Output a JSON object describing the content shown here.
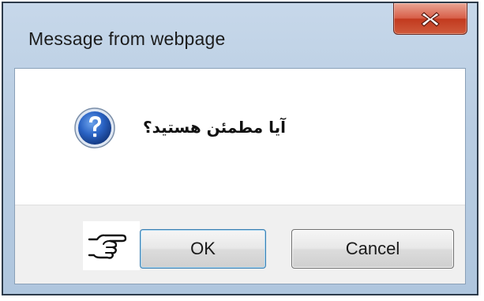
{
  "dialog": {
    "title": "Message from webpage",
    "close_icon": "close-icon",
    "message": "آیا مطمئن هستید؟",
    "message_icon": "question-icon",
    "pointer_icon": "pointing-hand-icon"
  },
  "buttons": {
    "ok_label": "OK",
    "cancel_label": "Cancel"
  },
  "colors": {
    "close_button": "#c9452a",
    "question_icon": "#1f56b0",
    "frame": "#b9cde2"
  }
}
